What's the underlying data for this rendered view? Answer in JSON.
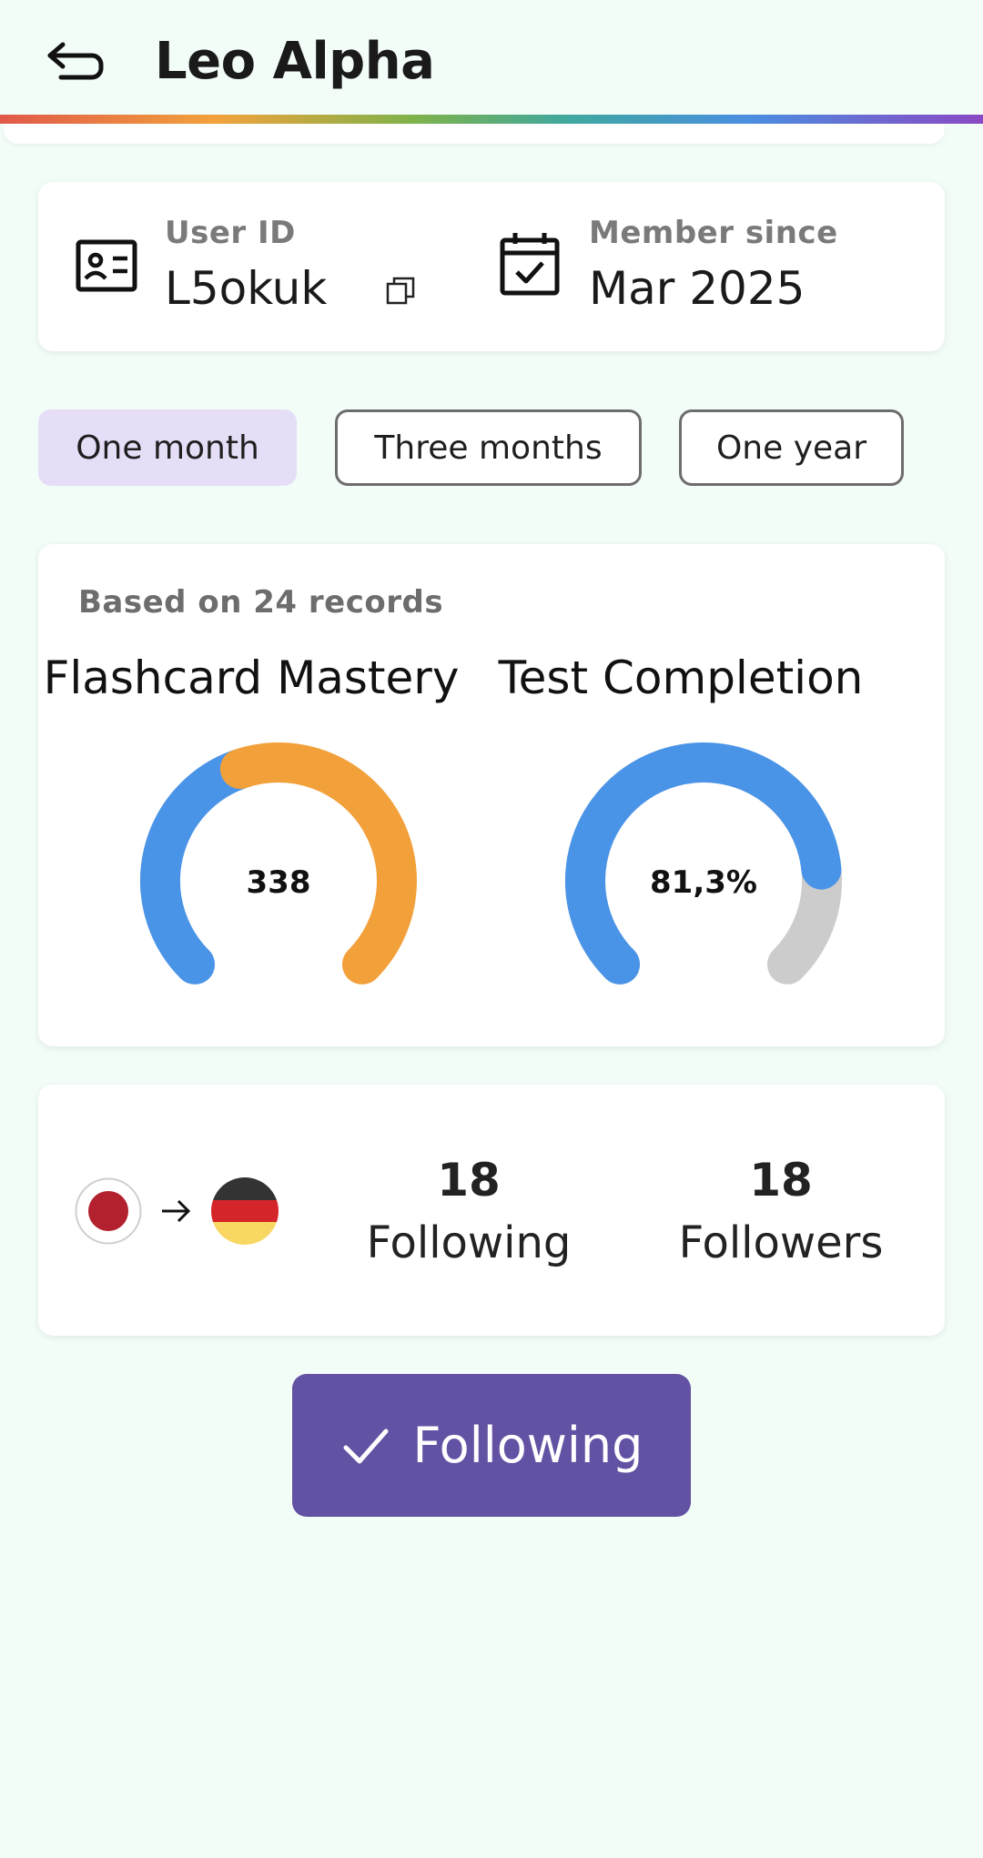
{
  "header": {
    "title": "Leo Alpha",
    "back_icon": "back-arrow-icon"
  },
  "profile": {
    "user_id_label": "User ID",
    "user_id": "L5okuk",
    "member_since_label": "Member since",
    "member_since": "Mar 2025"
  },
  "periods": {
    "options": [
      "One month",
      "Three months",
      "One year"
    ],
    "selected": "One month"
  },
  "stats": {
    "records_text": "Based on 24 records",
    "flashcard": {
      "title": "Flashcard Mastery",
      "value_text": "338",
      "segments": [
        {
          "fraction": 0.43,
          "color": "#4a94e8"
        },
        {
          "fraction": 0.57,
          "color": "#f2a03a"
        }
      ]
    },
    "test": {
      "title": "Test Completion",
      "value_text": "81,3%",
      "fraction": 0.813,
      "fill_color": "#4a94e8",
      "track_color": "#cccccc"
    }
  },
  "social": {
    "from_language_flag": "japan-flag-icon",
    "to_language_flag": "germany-flag-icon",
    "following_count": "18",
    "following_label": "Following",
    "followers_count": "18",
    "followers_label": "Followers"
  },
  "follow_button": {
    "label": "Following",
    "accent": "#6351a3"
  }
}
